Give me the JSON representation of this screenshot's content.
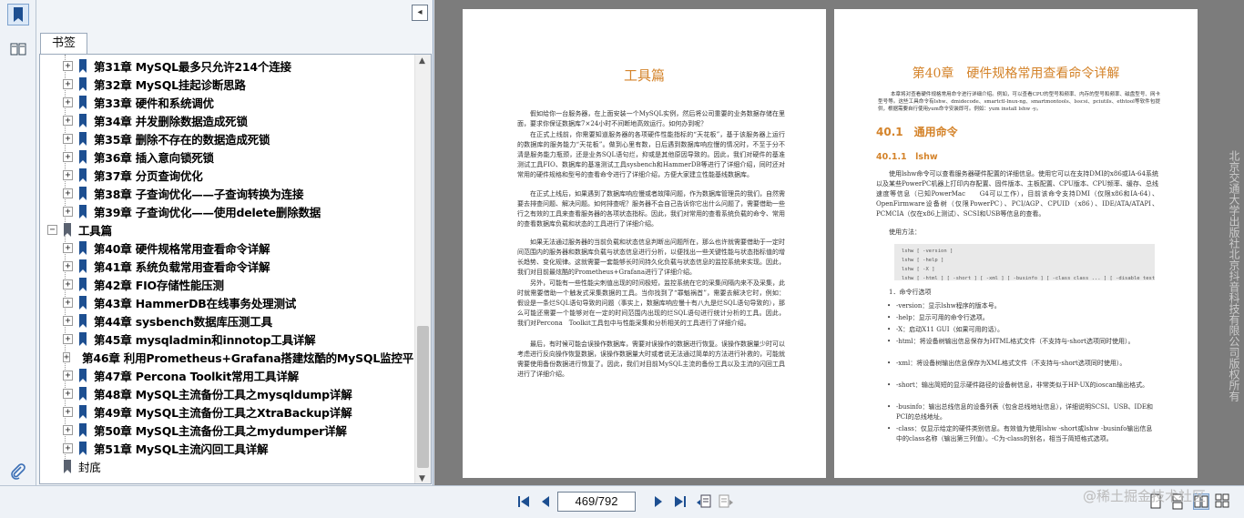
{
  "panel": {
    "tab_label": "书签",
    "collapse_glyph": "◂"
  },
  "tree": {
    "items": [
      {
        "label": "第31章 MySQL最多只允许214个连接",
        "level": 1
      },
      {
        "label": "第32章 MySQL挂起诊断思路",
        "level": 1
      },
      {
        "label": "第33章 硬件和系统调优",
        "level": 1
      },
      {
        "label": "第34章 并发删除数据造成死锁",
        "level": 1
      },
      {
        "label": "第35章 删除不存在的数据造成死锁",
        "level": 1
      },
      {
        "label": "第36章 插入意向锁死锁",
        "level": 1
      },
      {
        "label": "第37章 分页查询优化",
        "level": 1
      },
      {
        "label": "第38章 子查询优化——子查询转换为连接",
        "level": 1
      },
      {
        "label": "第39章 子查询优化——使用delete删除数据",
        "level": 1
      },
      {
        "label": "工具篇",
        "level": 0
      },
      {
        "label": "第40章 硬件规格常用查看命令详解",
        "level": 1
      },
      {
        "label": "第41章 系统负载常用查看命令详解",
        "level": 1
      },
      {
        "label": "第42章 FIO存储性能压测",
        "level": 1
      },
      {
        "label": "第43章 HammerDB在线事务处理测试",
        "level": 1
      },
      {
        "label": "第44章 sysbench数据库压测工具",
        "level": 1
      },
      {
        "label": "第45章 mysqladmin和innotop工具详解",
        "level": 1
      },
      {
        "label": "第46章 利用Prometheus+Grafana搭建炫酷的MySQL监控平台",
        "level": 1
      },
      {
        "label": "第47章 Percona Toolkit常用工具详解",
        "level": 1
      },
      {
        "label": "第48章 MySQL主流备份工具之mysqldump详解",
        "level": 1
      },
      {
        "label": "第49章 MySQL主流备份工具之XtraBackup详解",
        "level": 1
      },
      {
        "label": "第50章 MySQL主流备份工具之mydumper详解",
        "level": 1
      },
      {
        "label": "第51章 MySQL主流闪回工具详解",
        "level": 1
      },
      {
        "label": "封底",
        "level": 0
      }
    ]
  },
  "left_page": {
    "title": "工具篇",
    "paragraphs": [
      "假如给你一台服务器，在上面安装一个MySQL实例，然后将公司重要的业务数据存储在里面，要求你保证数据库7×24小时不间断地高效运行。如何办到呢？",
      "在正式上线前，你需要知道服务器的各项硬件性能指标的“天花板”，基于该服务器上运行的数据库的服务能力“天花板”。做到心里有数，日后遇到数据库响应慢的情况时，不至于分不清是服务能力瓶颈，还是业务SQL语句烂，抑或是其他原因导致的。因此，我们对硬件的基准测试工具FIO、数据库的基准测试工具sysbench和HammerDB等进行了详细介绍，同时还对常用的硬件规格和型号的查看命令进行了详细介绍，方便大家建立性能基线数据库。",
      "在正式上线后，如果遇到了数据库响应慢或者故障问题，作为数据库管理员的我们，自然需要去排查问题、解决问题。如何排查呢？服务器不会自己告诉你它出什么问题了，需要借助一些行之有效的工具来查看服务器的各项状态指标。因此，我们对常用的查看系统负载的命令、常用的查看数据库负载和状态的工具进行了详细介绍。",
      "如果无法通过服务器的当前负载和状态信息判断出问题所在，那么也许就需要借助于一定时间范围内的服务器和数据库负载与状态信息进行分析，以便找出一些关键性能与状态指标值的增长趋势、变化规律。这就需要一套能够长时间持久化负载与状态信息的监控系统来实现。因此，我们对目前最炫酷的Prometheus+Grafana进行了详细介绍。",
      "另外，可能有一些性能尖刺值出现的时间极短，监控系统在它的采集间隔内来不及采集，此时就需要借助一个触发式采集数据的工具。当你找到了“罪魁祸首”，需要去解决它时，例如：假设是一条烂SQL语句导致的问题（事实上，数据库响应慢十有八九是烂SQL语句导致的），那么可能还需要一个能够对在一定的时间范围内出现的烂SQL语句进行统计分析的工具。因此，我们对Percona　Toolkit工具包中与性能采集和分析相关的工具进行了详细介绍。",
      "最后，有时候可能会误操作数据库，需要对误操作的数据进行恢复。误操作数据量少时可以考虑进行反向操作恢复数据，误操作数据量大时或者说无法通过简单的方法进行补救的，可能就需要使用备份数据进行恢复了。因此，我们对目前MySQL主流的备份工具以及主流的闪回工具进行了详细介绍。"
    ]
  },
  "right_page": {
    "chapter_title": "第40章　硬件规格常用查看命令详解",
    "intro": "本章将对查看硬件规格常用命令进行详细介绍。例如，可以查看CPU的型号和频率、内存的型号和频率、磁盘型号、网卡型号等。这些工具命令有lshw、dmidecode、smartctl-lnux-ng、smartmontools、lsscsi、pciutils、ethtool等软件包提供，根据需要自行使用yum命令安装即可。例如：yum install lshw -y。",
    "section": "40.1　通用命令",
    "subsection": "40.1.1　lshw",
    "body": "使用lshw命令可以查看服务器硬件配置的详细信息。使用它可以在支持DMI的x86或IA-64系统以及某些PowerPC机器上打印内存配置、固件版本、主板配置、CPU版本、CPU频率、缓存、总线速度等信息（已知PowerMac　　G4可以工作），目前该命令支持DMI（仅限x86和IA-64）、OpenFirmware设备树（仅限PowerPC）、PCI/AGP、CPUID（x86）、IDE/ATA/ATAPI、PCMCIA（仅在x86上测试）、SCSI和USB等信息的查看。",
    "usage_label": "使用方法：",
    "code_lines": [
      "lshw [ -version ]",
      "lshw [ -help ]",
      "lshw [ -X ]",
      "lshw [ -html ] [ -short ] [ -xml ] [ -businfo ] [ -class class ... ] [ -disable test ... ] [ -enable",
      "test ... ] [ -sanitize ] [ -numeric ] [ -quiet ]"
    ],
    "options_heading": "1．命令行选项",
    "options": [
      "-version：显示lshw程序的版本号。",
      "-help：显示可用的命令行选项。",
      "-X：启动X11 GUI（如果可用的话）。",
      "-html：将设备树输出信息保存为HTML格式文件（不支持与-short选项同时使用）。",
      "-xml：将设备树输出信息保存为XML格式文件（不支持与-short选项同时使用）。",
      "-short：输出简短的显示硬件路径的设备树信息，非常类似于HP-UX的ioscan输出格式。",
      "-businfo：输出总线信息的设备列表（包含总线地址信息），详细说明SCSI、USB、IDE和PCI的总线地址。",
      "-class：仅显示给定的硬件类别信息。有效值为使用lshw -short或lshw -businfo输出信息中的class名称（输出第三列值）。-C为-class的别名，相当于简短格式选项。"
    ]
  },
  "watermark": {
    "side": "北京交通大学出版社北京抖音科技有限公司版权所有",
    "corner": "@稀土掘金技术社区"
  },
  "nav": {
    "page_indicator": "469/792"
  }
}
